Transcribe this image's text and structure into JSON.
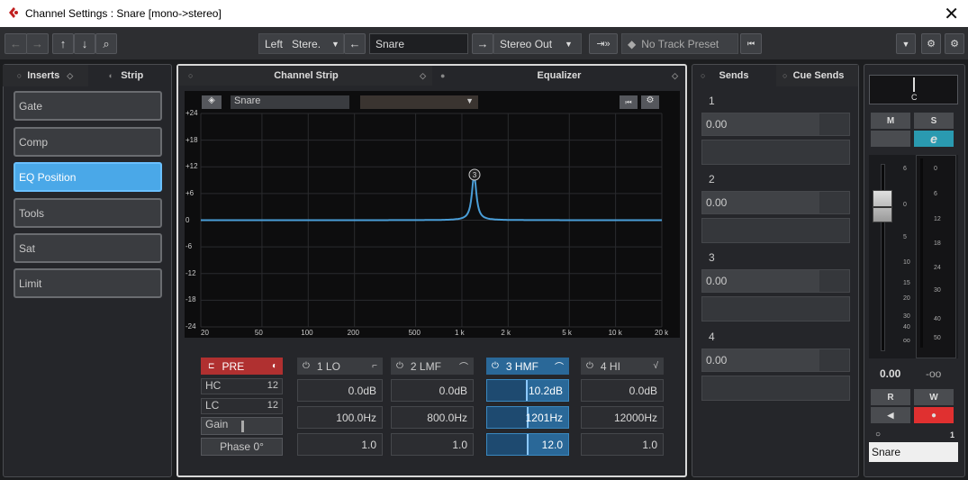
{
  "window": {
    "title": "Channel Settings : Snare [mono->stereo]"
  },
  "toolbar": {
    "routing_left": "Left",
    "routing_stereo": "Stere.",
    "channel_name": "Snare",
    "output": "Stereo Out",
    "preset": "No Track Preset"
  },
  "left_panel": {
    "tabs": [
      "Inserts",
      "Strip"
    ],
    "strip_modules": [
      "Gate",
      "Comp",
      "EQ Position",
      "Tools",
      "Sat",
      "Limit"
    ]
  },
  "eq_panel": {
    "tabs": [
      "Channel Strip",
      "Equalizer"
    ],
    "channel_label": "Snare",
    "point_label": "3",
    "y_ticks": [
      "+24",
      "+18",
      "+12",
      "+6",
      "0",
      "-6",
      "-12",
      "-18",
      "-24"
    ],
    "x_ticks": [
      "20",
      "50",
      "100",
      "200",
      "500",
      "1 k",
      "2 k",
      "5 k",
      "10 k",
      "20 k"
    ],
    "pre": {
      "label": "PRE",
      "hc": "HC",
      "lc": "LC",
      "hc_val": "12",
      "lc_val": "12",
      "gain": "Gain",
      "phase": "Phase 0°"
    },
    "bands": [
      {
        "name": "1 LO",
        "gain": "0.0dB",
        "freq": "100.0Hz",
        "q": "1.0"
      },
      {
        "name": "2 LMF",
        "gain": "0.0dB",
        "freq": "800.0Hz",
        "q": "1.0"
      },
      {
        "name": "3 HMF",
        "gain": "10.2dB",
        "freq": "1201Hz",
        "q": "12.0"
      },
      {
        "name": "4 HI",
        "gain": "0.0dB",
        "freq": "12000Hz",
        "q": "1.0"
      }
    ]
  },
  "sends_panel": {
    "tabs": [
      "Sends",
      "Cue Sends"
    ],
    "sends": [
      {
        "num": "1",
        "value": "0.00"
      },
      {
        "num": "2",
        "value": "0.00"
      },
      {
        "num": "3",
        "value": "0.00"
      },
      {
        "num": "4",
        "value": "0.00"
      }
    ]
  },
  "fader_panel": {
    "pan": "C",
    "mute": "M",
    "solo": "S",
    "edit": "e",
    "read": "R",
    "write": "W",
    "volume": "0.00",
    "peak": "-oo",
    "fader_scale": [
      "6",
      "0",
      "5",
      "10",
      "15",
      "20",
      "30",
      "40",
      "oo"
    ],
    "meter_scale": [
      "0",
      "6",
      "12",
      "18",
      "24",
      "30",
      "40",
      "50"
    ],
    "channel_number": "1",
    "channel_name": "Snare"
  },
  "colors": {
    "accent": "#4aa8e8",
    "eq_curve": "#4a9ed8",
    "record": "#e03030",
    "edit": "#2a9ab0",
    "pre_red": "#b03030"
  }
}
